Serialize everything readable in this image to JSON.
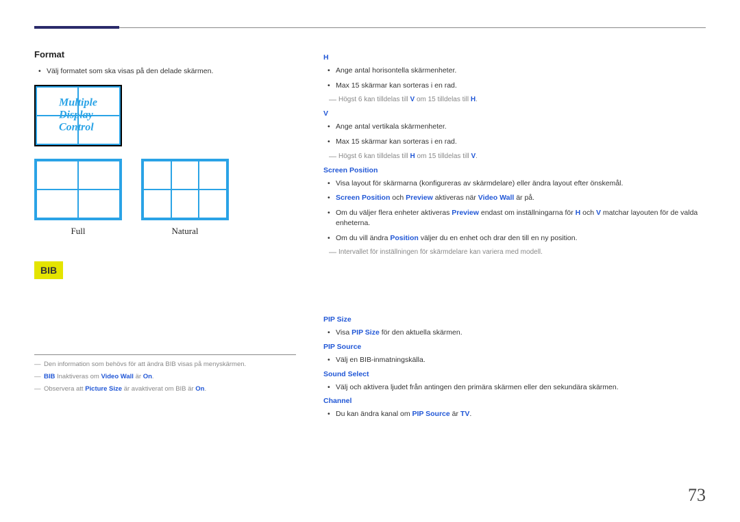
{
  "page_number": "73",
  "left": {
    "format": {
      "heading": "Format",
      "desc": "Välj formatet som ska visas på den delade skärmen.",
      "mdc_line1": "Multiple",
      "mdc_line2": "Display",
      "mdc_line3": "Control",
      "full_label": "Full",
      "natural_label": "Natural"
    },
    "bib_badge": "BIB",
    "footnotes": {
      "f1_pre": "Den information som behövs för att ändra BIB visas på menyskärmen.",
      "f2_pre": "BIB",
      "f2_mid": " Inaktiveras om ",
      "f2_link": "Video Wall",
      "f2_post": " är ",
      "f2_on": "On",
      "f2_end": ".",
      "f3_pre": "Observera att ",
      "f3_link": "Picture Size",
      "f3_mid": " är avaktiverat om BIB är ",
      "f3_on": "On",
      "f3_end": "."
    }
  },
  "right": {
    "h": {
      "head": "H",
      "b1": "Ange antal horisontella skärmenheter.",
      "b2": "Max 15 skärmar kan sorteras i en rad.",
      "note_pre": "Högst 6 kan tilldelas till ",
      "note_v": "V",
      "note_mid": " om 15 tilldelas till ",
      "note_h": "H",
      "note_end": "."
    },
    "v": {
      "head": "V",
      "b1": "Ange antal vertikala skärmenheter.",
      "b2": "Max 15 skärmar kan sorteras i en rad.",
      "note_pre": "Högst 6 kan tilldelas till ",
      "note_h": "H",
      "note_mid": " om 15 tilldelas till ",
      "note_v": "V",
      "note_end": "."
    },
    "sp": {
      "head": "Screen Position",
      "b1": "Visa layout för skärmarna (konfigureras av skärmdelare) eller ändra layout efter önskemål.",
      "b2_sp": "Screen Position",
      "b2_mid1": " och ",
      "b2_pv": "Preview",
      "b2_mid2": " aktiveras när ",
      "b2_vw": "Video Wall",
      "b2_end": " är på.",
      "b3_pre": "Om du väljer flera enheter aktiveras ",
      "b3_pv": "Preview",
      "b3_mid1": " endast om inställningarna för ",
      "b3_h": "H",
      "b3_mid2": " och ",
      "b3_v": "V",
      "b3_end": " matchar layouten för de valda enheterna.",
      "b4_pre": "Om du vill ändra ",
      "b4_pos": "Position",
      "b4_end": " väljer du en enhet och drar den till en ny position.",
      "note": "Intervallet för inställningen för skärmdelare kan variera med modell."
    },
    "pip": {
      "size_head": "PIP Size",
      "size_b_pre": "Visa ",
      "size_b_link": "PIP Size",
      "size_b_end": " för den aktuella skärmen.",
      "source_head": "PIP Source",
      "source_b": "Välj en BIB-inmatningskälla.",
      "sound_head": "Sound Select",
      "sound_b": "Välj och aktivera ljudet från antingen den primära skärmen eller den sekundära skärmen.",
      "channel_head": "Channel",
      "channel_b_pre": "Du kan ändra kanal om ",
      "channel_b_link": "PIP Source",
      "channel_b_mid": " är ",
      "channel_b_tv": "TV",
      "channel_b_end": "."
    }
  }
}
